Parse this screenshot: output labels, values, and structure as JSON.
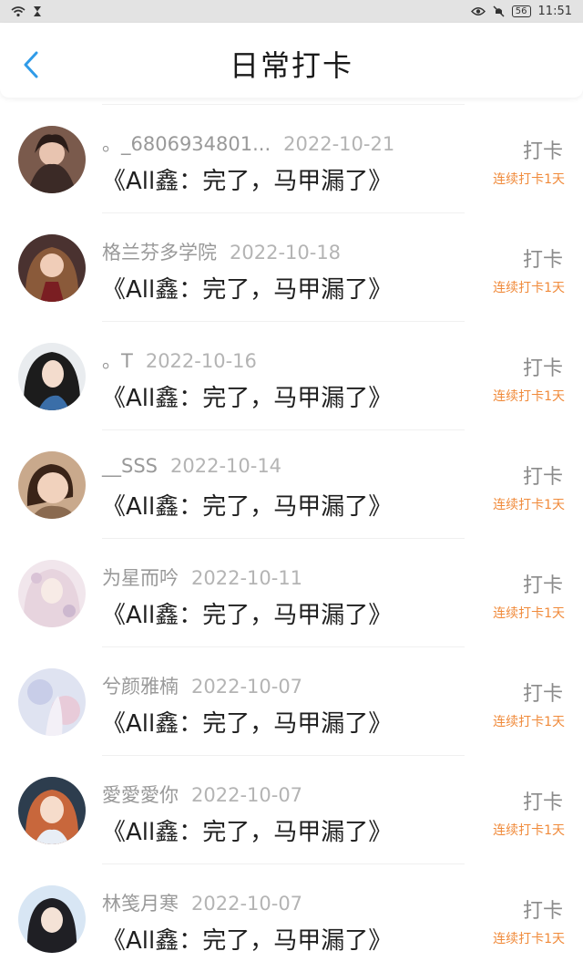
{
  "status_bar": {
    "time": "11:51",
    "battery": "56"
  },
  "header": {
    "title": "日常打卡"
  },
  "entries": [
    {
      "user": "。_6806934801...",
      "date": "2022-10-21",
      "content": "《All鑫：完了，马甲漏了》",
      "action": "打卡",
      "streak": "连续打卡1天"
    },
    {
      "user": "格兰芬多学院",
      "date": "2022-10-18",
      "content": "《All鑫：完了，马甲漏了》",
      "action": "打卡",
      "streak": "连续打卡1天"
    },
    {
      "user": "。T",
      "date": "2022-10-16",
      "content": "《All鑫：完了，马甲漏了》",
      "action": "打卡",
      "streak": "连续打卡1天"
    },
    {
      "user": "__SSS",
      "date": "2022-10-14",
      "content": "《All鑫：完了，马甲漏了》",
      "action": "打卡",
      "streak": "连续打卡1天"
    },
    {
      "user": "为星而吟",
      "date": "2022-10-11",
      "content": "《All鑫：完了，马甲漏了》",
      "action": "打卡",
      "streak": "连续打卡1天"
    },
    {
      "user": "兮颜雅楠",
      "date": "2022-10-07",
      "content": "《All鑫：完了，马甲漏了》",
      "action": "打卡",
      "streak": "连续打卡1天"
    },
    {
      "user": "愛愛愛你",
      "date": "2022-10-07",
      "content": "《All鑫：完了，马甲漏了》",
      "action": "打卡",
      "streak": "连续打卡1天"
    },
    {
      "user": "林笺月寒",
      "date": "2022-10-07",
      "content": "《All鑫：完了，马甲漏了》",
      "action": "打卡",
      "streak": "连续打卡1天"
    }
  ],
  "colors": {
    "accent_blue": "#2f9be8",
    "streak_orange": "#f08a3a",
    "status_bar_bg": "#e3e3e3"
  }
}
